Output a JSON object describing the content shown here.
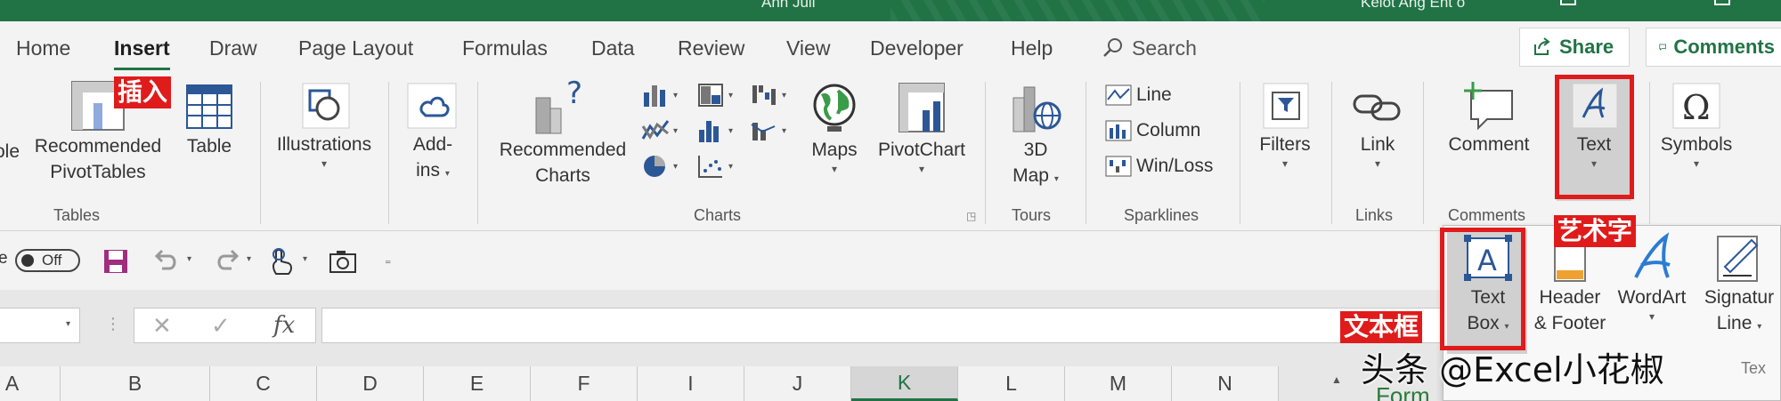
{
  "titlebar": {
    "title": "Ann Juli",
    "user": "Kelot Ang Ent o"
  },
  "tabs": [
    "Home",
    "Insert",
    "Draw",
    "Page Layout",
    "Formulas",
    "Data",
    "Review",
    "View",
    "Developer",
    "Help"
  ],
  "search": {
    "label": "Search"
  },
  "share": {
    "label": "Share"
  },
  "comments": {
    "label": "Comments"
  },
  "ribbon": {
    "tables": {
      "partial_label": "ole",
      "recommended_pivot": [
        "Recommended",
        "PivotTables"
      ],
      "table": "Table",
      "group_label": "Tables"
    },
    "illustrations": {
      "label": "Illustrations"
    },
    "addins": {
      "label": [
        "Add-",
        "ins"
      ]
    },
    "charts": {
      "recommended": [
        "Recommended",
        "Charts"
      ],
      "maps": "Maps",
      "pivotchart": "PivotChart",
      "group_label": "Charts"
    },
    "tours": {
      "label": [
        "3D",
        "Map"
      ],
      "group_label": "Tours"
    },
    "sparklines": {
      "line": "Line",
      "column": "Column",
      "winloss": "Win/Loss",
      "group_label": "Sparklines"
    },
    "filters": {
      "label": "Filters"
    },
    "links": {
      "link": "Link",
      "group_label": "Links"
    },
    "comments": {
      "comment": "Comment",
      "group_label": "Comments"
    },
    "text": {
      "label": "Text"
    },
    "symbols": {
      "label": "Symbols"
    }
  },
  "qat": {
    "autosave_partial": "e",
    "toggle_state": "Off"
  },
  "formula_bar": {
    "fx": "fx",
    "cancel": "✕",
    "enter": "✓"
  },
  "columns": [
    "A",
    "B",
    "C",
    "D",
    "E",
    "F",
    "I",
    "J",
    "K",
    "L",
    "M",
    "N"
  ],
  "selected_column": "K",
  "text_panel": {
    "textbox": [
      "Text",
      "Box"
    ],
    "header_footer": [
      "Header",
      "& Footer"
    ],
    "wordart": "WordArt",
    "signature": [
      "Signatur",
      "Line"
    ],
    "bottom_partial": "Tex"
  },
  "annotations": {
    "insert": "插入",
    "wordart": "艺术字",
    "textbox": "文本框"
  },
  "watermark": "头条 @Excel小花椒",
  "side_partial": "Form"
}
